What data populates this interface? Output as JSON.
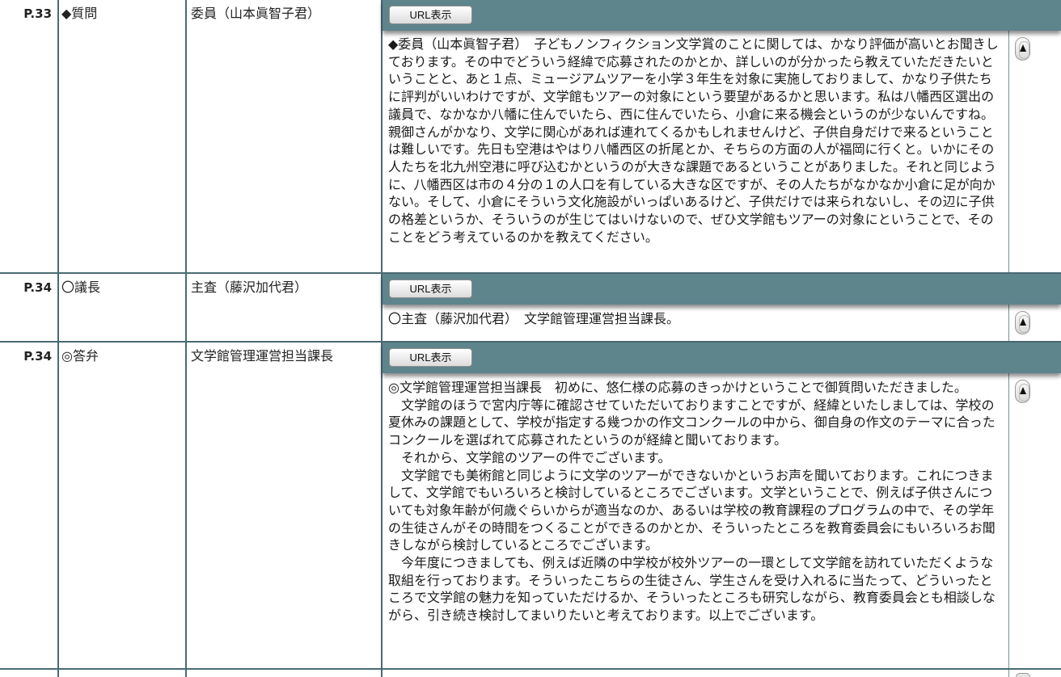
{
  "rows": [
    {
      "page": "P.33",
      "kind": "◆質問",
      "speaker": "委員（山本眞智子君）",
      "url_label": "URL表示",
      "text": "◆委員（山本眞智子君）　子どもノンフィクション文学賞のことに関しては、かなり評価が高いとお聞きしております。その中でどういう経緯で応募されたのかとか、詳しいのが分かったら教えていただきたいということと、あと１点、ミュージアムツアーを小学３年生を対象に実施しておりまして、かなり子供たちに評判がいいわけですが、文学館もツアーの対象にという要望があるかと思います。私は八幡西区選出の議員で、なかなか八幡に住んでいたら、西に住んでいたら、小倉に来る機会というのが少ないんですね。親御さんがかなり、文学に関心があれば連れてくるかもしれませんけど、子供自身だけで来るということは難しいです。先日も空港はやはり八幡西区の折尾とか、そちらの方面の人が福岡に行くと。いかにその人たちを北九州空港に呼び込むかというのが大きな課題であるということがありました。それと同じように、八幡西区は市の４分の１の人口を有している大きな区ですが、その人たちがなかなか小倉に足が向かない。そして、小倉にそういう文化施設がいっぱいあるけど、子供だけでは来られないし、その辺に子供の格差というか、そういうのが生じてはいけないので、ぜひ文学館もツアーの対象にということで、そのことをどう考えているのかを教えてください。"
    },
    {
      "page": "P.34",
      "kind": "〇議長",
      "speaker": "主査（藤沢加代君）",
      "url_label": "URL表示",
      "text": "〇主査（藤沢加代君）　文学館管理運営担当課長。"
    },
    {
      "page": "P.34",
      "kind": "◎答弁",
      "speaker": "文学館管理運営担当課長",
      "url_label": "URL表示",
      "text": "◎文学館管理運営担当課長　初めに、悠仁様の応募のきっかけということで御質問いただきました。\n　文学館のほうで宮内庁等に確認させていただいておりますことですが、経緯といたしましては、学校の夏休みの課題として、学校が指定する幾つかの作文コンクールの中から、御自身の作文のテーマに合ったコンクールを選ばれて応募されたというのが経緯と聞いております。\n　それから、文学館のツアーの件でございます。\n　文学館でも美術館と同じように文学のツアーができないかというお声を聞いております。これにつきまして、文学館でもいろいろと検討しているところでございます。文学ということで、例えば子供さんについても対象年齢が何歳ぐらいからが適当なのか、あるいは学校の教育課程のプログラムの中で、その学年の生徒さんがその時間をつくることができるのかとか、そういったところを教育委員会にもいろいろお聞きしながら検討しているところでございます。\n　今年度につきましても、例えば近隣の中学校が校外ツアーの一環として文学館を訪れていただくような取組を行っております。そういったこちらの生徒さん、学生さんを受け入れるに当たって、どういったところで文学館の魅力を知っていただけるか、そういったところも研究しながら、教育委員会とも相談しながら、引き続き検討してまいりたいと考えております。以上でございます。"
    }
  ]
}
